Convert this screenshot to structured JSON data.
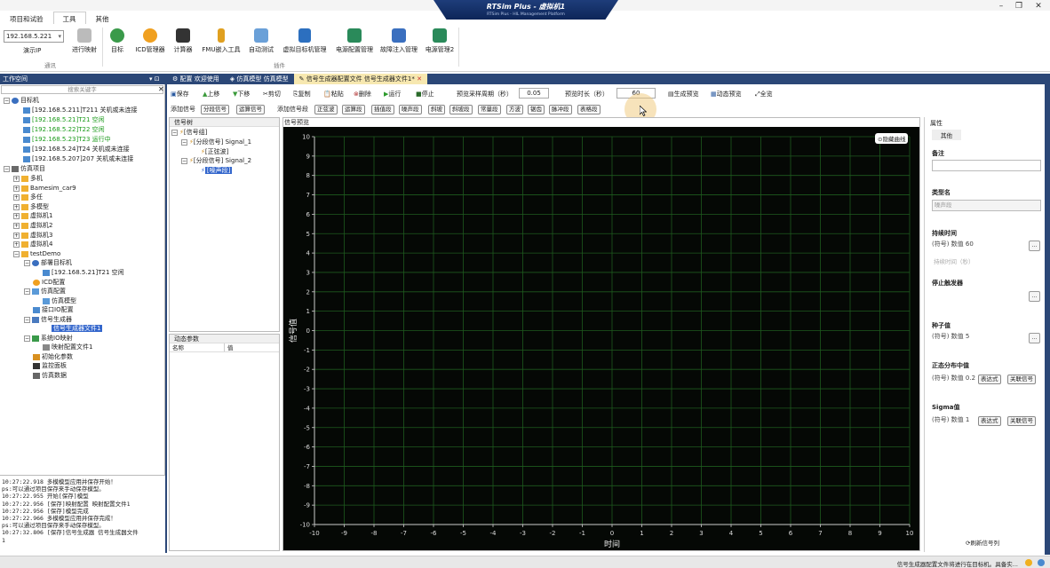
{
  "brand": {
    "title": "RTSim Plus - 虚拟机1",
    "subtitle": "RTSim Plus - HIL Management Platform"
  },
  "menu_tabs": [
    "项目和试验",
    "工具",
    "其他"
  ],
  "ribbon": {
    "ip_value": "192.168.5.221",
    "ip_label": "演示IP",
    "buttons": [
      "进行映射",
      "目标",
      "ICD管理器",
      "计算器",
      "FMU嵌入工具",
      "自动测试",
      "虚拟目标机管理",
      "电源配置管理",
      "故障注入管理",
      "电源管理2"
    ],
    "group_labels": [
      "通讯",
      "插件"
    ]
  },
  "workspace": {
    "title": "工作空间",
    "search_placeholder": "搜索关键字",
    "tree": [
      "目标机",
      "[192.168.5.211]T211 关机或未连接",
      "[192.168.5.21]T21 空闲",
      "[192.168.5.22]T22 空闲",
      "[192.168.5.23]T23 运行中",
      "[192.168.5.24]T24 关机或未连接",
      "[192.168.5.207]207 关机或未连接",
      "仿真项目",
      "多机",
      "Bamesim_car9",
      "多任",
      "多模型",
      "虚拟机1",
      "虚拟机2",
      "虚拟机3",
      "虚拟机4",
      "testDemo",
      "部署目标机",
      "[192.168.5.21]T21 空闲",
      "ICD配置",
      "仿真配置",
      "仿真模型",
      "接口IO配置",
      "信号生成器",
      "信号生成器文件1",
      "系统IO映射",
      "映射配置文件1",
      "初始化参数",
      "监控面板",
      "仿真数据"
    ]
  },
  "log_lines": [
    "10:27:22.918 多模模型应用并保存开始！",
    "ps:可以通过项目保存来手动保存模型。",
    "10:27:22.955 开始[保存]模型",
    "10:27:22.956 [保存]映射配置 映射配置文件1",
    "10:27:22.956 [保存]模型完成",
    "10:27:22.966 多模模型应用并保存完成！",
    "ps:可以通过项目保存来手动保存模型。",
    "10:27:32.806 [保存]信号生成器 信号生成器文件",
    "1"
  ],
  "doc_tabs": [
    "配置 欢迎使用",
    "仿真模型 仿真模型",
    "信号生成器配置文件 信号生成器文件1*"
  ],
  "toolbar": {
    "save": "保存",
    "up": "上移",
    "down": "下移",
    "cut": "剪切",
    "copy": "复制",
    "paste": "粘贴",
    "delete": "删除",
    "run": "运行",
    "stop": "停止",
    "sample_label": "预览采样周期（秒）",
    "sample_value": "0.05",
    "duration_label": "预览时长（秒）",
    "duration_value": "60",
    "gen_preview": "生成预览",
    "dyn_preview": "动态预览",
    "full_preview": "全览"
  },
  "toolbar2": {
    "add_signal_label": "添加信号",
    "add_signal_btns": [
      "分段信号",
      "运算信号"
    ],
    "add_sub_label": "添加信号段",
    "add_sub_btns": [
      "正弦波",
      "运算段",
      "插值段",
      "噪声段",
      "斜坡",
      "斜坡段",
      "常量段",
      "方波",
      "锯齿",
      "脉冲段",
      "表格段"
    ]
  },
  "signal_panel": {
    "title": "信号树",
    "tree": [
      "[信号组]",
      "[分段信号] Signal_1",
      "[正弦波]",
      "[分段信号] Signal_2",
      "[噪声段]"
    ]
  },
  "dyn_params": {
    "title": "动态参数",
    "col_name": "名称",
    "col_value": "值"
  },
  "preview_title": "信号预览",
  "hide_curve": "隐藏曲线",
  "chart_data": {
    "type": "line",
    "xlabel": "时间",
    "ylabel": "信号值",
    "xlim": [
      -10,
      10
    ],
    "ylim": [
      -10,
      10
    ],
    "grid": true,
    "x_ticks": [
      -10,
      -9,
      -8,
      -7,
      -6,
      -5,
      -4,
      -3,
      -2,
      -1,
      0,
      1,
      2,
      3,
      4,
      5,
      6,
      7,
      8,
      9,
      10
    ],
    "y_ticks": [
      -10,
      -9,
      -8,
      -7,
      -6,
      -5,
      -4,
      -3,
      -2,
      -1,
      0,
      1,
      2,
      3,
      4,
      5,
      6,
      7,
      8,
      9,
      10
    ],
    "series": []
  },
  "properties": {
    "title": "属性",
    "tab": "其他",
    "note_label": "备注",
    "type_label": "类型名",
    "type_value": "噪声段",
    "duration_label": "持续时间",
    "duration_value": "(符号) 数值 60",
    "duration_sub": "持续时间（秒）",
    "stop_label": "停止触发器",
    "seed_label": "种子值",
    "seed_value": "(符号) 数值 5",
    "mean_label": "正态分布中值",
    "mean_value": "(符号) 数值 0.2",
    "sigma_label": "Sigma值",
    "sigma_value": "(符号) 数值 1",
    "expr_btn": "表达式",
    "link_btn": "关联信号",
    "refresh": "刷新信号列"
  },
  "status_text": "信号生成器配置文件将进行在目标机。具备实...",
  "colors": {
    "dark_bar": "#2b4777",
    "chart_bg": "#050805",
    "grid": "#1e5a1e",
    "selected": "#3366cc"
  }
}
